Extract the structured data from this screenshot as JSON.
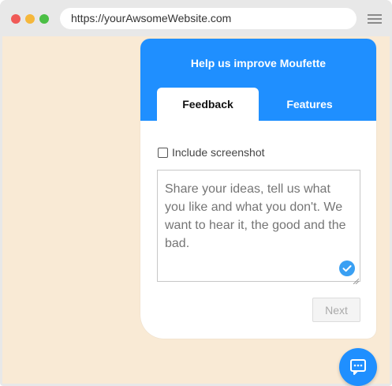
{
  "browser": {
    "url": "https://yourAwsomeWebsite.com",
    "window_buttons": [
      "close",
      "minimize",
      "maximize"
    ],
    "menu_icon": "hamburger-icon"
  },
  "widget": {
    "title": "Help us improve Moufette",
    "tabs": [
      {
        "label": "Feedback",
        "active": true
      },
      {
        "label": "Features",
        "active": false
      }
    ],
    "include_screenshot_label": "Include screenshot",
    "include_screenshot_checked": false,
    "textarea_placeholder": "Share your ideas, tell us what you like and what you don't. We want to hear it, the good and the bad.",
    "next_label": "Next",
    "accent_color": "#1f8fff"
  },
  "launcher": {
    "icon": "chat-icon"
  }
}
